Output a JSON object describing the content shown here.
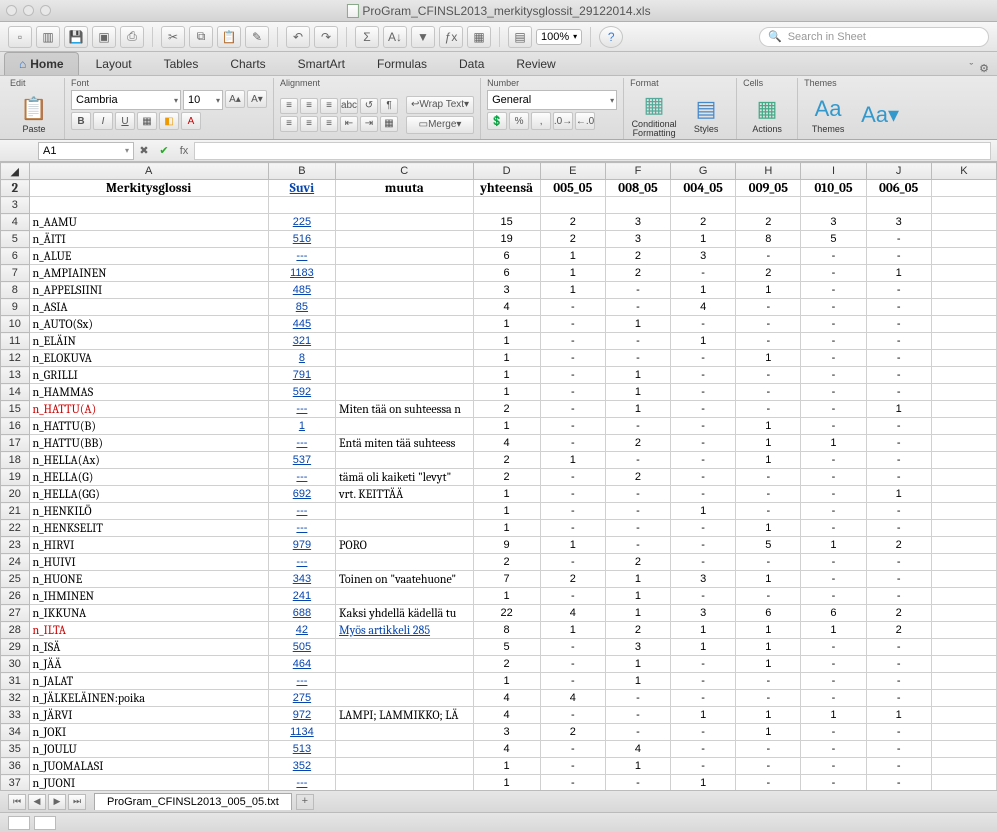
{
  "window": {
    "title": "ProGram_CFINSL2013_merkitysglossit_29122014.xls"
  },
  "toolbar": {
    "zoom": "100%",
    "search_placeholder": "Search in Sheet"
  },
  "ribbon_tabs": [
    "Home",
    "Layout",
    "Tables",
    "Charts",
    "SmartArt",
    "Formulas",
    "Data",
    "Review"
  ],
  "ribbon": {
    "edit": {
      "label": "Edit",
      "paste": "Paste"
    },
    "font": {
      "label": "Font",
      "name": "Cambria",
      "size": "10"
    },
    "alignment": {
      "label": "Alignment",
      "wrap": "Wrap Text",
      "merge": "Merge"
    },
    "number": {
      "label": "Number",
      "format": "General"
    },
    "format": {
      "label": "Format",
      "cond": "Conditional Formatting",
      "styles": "Styles"
    },
    "cells": {
      "label": "Cells",
      "actions": "Actions"
    },
    "themes": {
      "label": "Themes",
      "themes": "Themes",
      "aa": "Aa"
    }
  },
  "namebox": {
    "ref": "A1",
    "fx": "fx"
  },
  "columns": [
    "",
    "A",
    "B",
    "C",
    "D",
    "E",
    "F",
    "G",
    "H",
    "I",
    "J",
    "K"
  ],
  "header_row": {
    "row": "2",
    "A": "Merkitysglossi",
    "B": "Suvi",
    "C": "muuta",
    "D": "yhteensä",
    "E": "005_05",
    "F": "008_05",
    "G": "004_05",
    "H": "009_05",
    "I": "010_05",
    "J": "006_05"
  },
  "blank_row": "3",
  "rows": [
    {
      "n": "4",
      "A": "n_AAMU",
      "B": "225",
      "C": "",
      "D": "15",
      "E": "2",
      "F": "3",
      "G": "2",
      "H": "2",
      "I": "3",
      "J": "3"
    },
    {
      "n": "5",
      "A": "n_ÄITI",
      "B": "516",
      "C": "",
      "D": "19",
      "E": "2",
      "F": "3",
      "G": "1",
      "H": "8",
      "I": "5",
      "J": "-"
    },
    {
      "n": "6",
      "A": "n_ALUE",
      "B": "---",
      "C": "",
      "D": "6",
      "E": "1",
      "F": "2",
      "G": "3",
      "H": "-",
      "I": "-",
      "J": "-"
    },
    {
      "n": "7",
      "A": "n_AMPIAINEN",
      "B": "1183",
      "C": "",
      "D": "6",
      "E": "1",
      "F": "2",
      "G": "-",
      "H": "2",
      "I": "-",
      "J": "1"
    },
    {
      "n": "8",
      "A": "n_APPELSIINI",
      "B": "485",
      "C": "",
      "D": "3",
      "E": "1",
      "F": "-",
      "G": "1",
      "H": "1",
      "I": "-",
      "J": "-"
    },
    {
      "n": "9",
      "A": "n_ASIA",
      "B": "85",
      "C": "",
      "D": "4",
      "E": "-",
      "F": "-",
      "G": "4",
      "H": "-",
      "I": "-",
      "J": "-"
    },
    {
      "n": "10",
      "A": "n_AUTO(Sx)",
      "B": "445",
      "C": "",
      "D": "1",
      "E": "-",
      "F": "1",
      "G": "-",
      "H": "-",
      "I": "-",
      "J": "-"
    },
    {
      "n": "11",
      "A": "n_ELÄIN",
      "B": "321",
      "C": "",
      "D": "1",
      "E": "-",
      "F": "-",
      "G": "1",
      "H": "-",
      "I": "-",
      "J": "-"
    },
    {
      "n": "12",
      "A": "n_ELOKUVA",
      "B": "8",
      "C": "",
      "D": "1",
      "E": "-",
      "F": "-",
      "G": "-",
      "H": "1",
      "I": "-",
      "J": "-"
    },
    {
      "n": "13",
      "A": "n_GRILLI",
      "B": "791",
      "C": "",
      "D": "1",
      "E": "-",
      "F": "1",
      "G": "-",
      "H": "-",
      "I": "-",
      "J": "-"
    },
    {
      "n": "14",
      "A": "n_HAMMAS",
      "B": "592",
      "C": "",
      "D": "1",
      "E": "-",
      "F": "1",
      "G": "-",
      "H": "-",
      "I": "-",
      "J": "-"
    },
    {
      "n": "15",
      "A": "n_HATTU(A)",
      "Ared": true,
      "B": "---",
      "C": "Miten tää on suhteessa n",
      "D": "2",
      "E": "-",
      "F": "1",
      "G": "-",
      "H": "-",
      "I": "-",
      "J": "1"
    },
    {
      "n": "16",
      "A": "n_HATTU(B)",
      "B": "1",
      "C": "",
      "D": "1",
      "E": "-",
      "F": "-",
      "G": "-",
      "H": "1",
      "I": "-",
      "J": "-"
    },
    {
      "n": "17",
      "A": "n_HATTU(BB)",
      "B": "---",
      "C": "Entä miten tää suhteess",
      "D": "4",
      "E": "-",
      "F": "2",
      "G": "-",
      "H": "1",
      "I": "1",
      "J": "-"
    },
    {
      "n": "18",
      "A": "n_HELLA(Ax)",
      "B": "537",
      "C": "",
      "D": "2",
      "E": "1",
      "F": "-",
      "G": "-",
      "H": "1",
      "I": "-",
      "J": "-"
    },
    {
      "n": "19",
      "A": "n_HELLA(G)",
      "B": "---",
      "C": "tämä oli kaiketi \"levyt\"",
      "D": "2",
      "E": "-",
      "F": "2",
      "G": "-",
      "H": "-",
      "I": "-",
      "J": "-"
    },
    {
      "n": "20",
      "A": "n_HELLA(GG)",
      "B": "692",
      "C": "vrt. KEITTÄÄ",
      "D": "1",
      "E": "-",
      "F": "-",
      "G": "-",
      "H": "-",
      "I": "-",
      "J": "1"
    },
    {
      "n": "21",
      "A": "n_HENKILÖ",
      "B": "---",
      "C": "",
      "D": "1",
      "E": "-",
      "F": "-",
      "G": "1",
      "H": "-",
      "I": "-",
      "J": "-"
    },
    {
      "n": "22",
      "A": "n_HENKSELIT",
      "B": "---",
      "C": "",
      "D": "1",
      "E": "-",
      "F": "-",
      "G": "-",
      "H": "1",
      "I": "-",
      "J": "-"
    },
    {
      "n": "23",
      "A": "n_HIRVI",
      "B": "979",
      "C": "PORO",
      "D": "9",
      "E": "1",
      "F": "-",
      "G": "-",
      "H": "5",
      "I": "1",
      "J": "2"
    },
    {
      "n": "24",
      "A": "n_HUIVI",
      "B": "---",
      "C": "",
      "D": "2",
      "E": "-",
      "F": "2",
      "G": "-",
      "H": "-",
      "I": "-",
      "J": "-"
    },
    {
      "n": "25",
      "A": "n_HUONE",
      "B": "343",
      "C": "Toinen on \"vaatehuone\"",
      "D": "7",
      "E": "2",
      "F": "1",
      "G": "3",
      "H": "1",
      "I": "-",
      "J": "-"
    },
    {
      "n": "26",
      "A": "n_IHMINEN",
      "B": "241",
      "C": "",
      "D": "1",
      "E": "-",
      "F": "1",
      "G": "-",
      "H": "-",
      "I": "-",
      "J": "-"
    },
    {
      "n": "27",
      "A": "n_IKKUNA",
      "B": "688",
      "C": "Kaksi yhdellä kädellä tu",
      "D": "22",
      "E": "4",
      "F": "1",
      "G": "3",
      "H": "6",
      "I": "6",
      "J": "2"
    },
    {
      "n": "28",
      "A": "n_ILTA",
      "Ared": true,
      "B": "42",
      "C": "Myös artikkeli 285",
      "Clink": true,
      "D": "8",
      "E": "1",
      "F": "2",
      "G": "1",
      "H": "1",
      "I": "1",
      "J": "2"
    },
    {
      "n": "29",
      "A": "n_ISÄ",
      "B": "505",
      "C": "",
      "D": "5",
      "E": "-",
      "F": "3",
      "G": "1",
      "H": "1",
      "I": "-",
      "J": "-"
    },
    {
      "n": "30",
      "A": "n_JÄÄ",
      "B": "464",
      "C": "",
      "D": "2",
      "E": "-",
      "F": "1",
      "G": "-",
      "H": "1",
      "I": "-",
      "J": "-"
    },
    {
      "n": "31",
      "A": "n_JALAT",
      "B": "---",
      "C": "",
      "D": "1",
      "E": "-",
      "F": "1",
      "G": "-",
      "H": "-",
      "I": "-",
      "J": "-"
    },
    {
      "n": "32",
      "A": "n_JÄLKELÄINEN:poika",
      "B": "275",
      "C": "",
      "D": "4",
      "E": "4",
      "F": "-",
      "G": "-",
      "H": "-",
      "I": "-",
      "J": "-"
    },
    {
      "n": "33",
      "A": "n_JÄRVI",
      "B": "972",
      "C": "LAMPI; LAMMIKKO; LÄ",
      "D": "4",
      "E": "-",
      "F": "-",
      "G": "1",
      "H": "1",
      "I": "1",
      "J": "1"
    },
    {
      "n": "34",
      "A": "n_JOKI",
      "B": "1134",
      "C": "",
      "D": "3",
      "E": "2",
      "F": "-",
      "G": "-",
      "H": "1",
      "I": "-",
      "J": "-"
    },
    {
      "n": "35",
      "A": "n_JOULU",
      "B": "513",
      "C": "",
      "D": "4",
      "E": "-",
      "F": "4",
      "G": "-",
      "H": "-",
      "I": "-",
      "J": "-"
    },
    {
      "n": "36",
      "A": "n_JUOMALASI",
      "B": "352",
      "C": "",
      "D": "1",
      "E": "-",
      "F": "1",
      "G": "-",
      "H": "-",
      "I": "-",
      "J": "-"
    },
    {
      "n": "37",
      "A": "n_JUONI",
      "B": "---",
      "C": "",
      "D": "1",
      "E": "-",
      "F": "-",
      "G": "1",
      "H": "-",
      "I": "-",
      "J": "-"
    }
  ],
  "sheet_tab": "ProGram_CFINSL2013_005_05.txt"
}
